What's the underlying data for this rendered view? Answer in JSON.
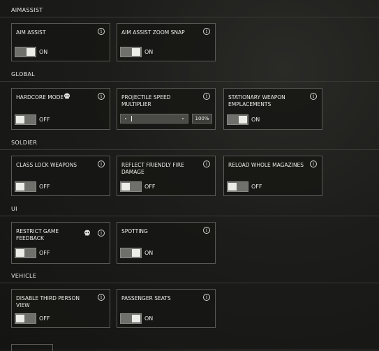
{
  "sections": {
    "aimassist": "AIMASSIST",
    "global": "GLOBAL",
    "soldier": "SOLDIER",
    "ui": "UI",
    "vehicle": "VEHICLE"
  },
  "settings": {
    "aim_assist": {
      "label": "AIM ASSIST",
      "state": "ON"
    },
    "aim_assist_zoom_snap": {
      "label": "AIM ASSIST ZOOM SNAP",
      "state": "ON"
    },
    "hardcore_mode": {
      "label": "HARDCORE MODE",
      "state": "OFF"
    },
    "projectile_speed_multiplier": {
      "label": "PROJECTILE SPEED MULTIPLIER",
      "value": "100%"
    },
    "stationary_weapon_emplacements": {
      "label": "STATIONARY WEAPON EMPLACEMENTS",
      "state": "ON"
    },
    "class_lock_weapons": {
      "label": "CLASS LOCK WEAPONS",
      "state": "OFF"
    },
    "reflect_friendly_fire_damage": {
      "label": "REFLECT FRIENDLY FIRE DAMAGE",
      "state": "OFF"
    },
    "reload_whole_magazines": {
      "label": "RELOAD WHOLE MAGAZINES",
      "state": "OFF"
    },
    "restrict_game_feedback": {
      "label": "RESTRICT GAME FEEDBACK",
      "state": "OFF"
    },
    "spotting": {
      "label": "SPOTTING",
      "state": "ON"
    },
    "disable_third_person_view": {
      "label": "DISABLE THIRD PERSON VIEW",
      "state": "OFF"
    },
    "passenger_seats": {
      "label": "PASSENGER SEATS",
      "state": "ON"
    }
  },
  "icons": {
    "info": "i",
    "info_icon_name": "info-icon",
    "skull_icon_name": "skull-icon"
  },
  "colors": {
    "background": "#1c1c1a",
    "card_border": "#5a5a56",
    "toggle_track": "#6f6f6b",
    "toggle_knob": "#ecece8",
    "text": "#ecece8"
  }
}
